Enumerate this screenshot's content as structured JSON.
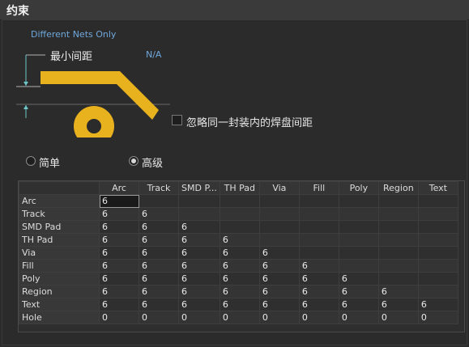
{
  "header": {
    "title": "约束"
  },
  "constraint": {
    "different_nets": "Different Nets Only",
    "min_clearance_label": "最小间距",
    "min_clearance_value": "N/A",
    "ignore_same_footprint_label": "忽略同一封装内的焊盘间距",
    "ignore_same_footprint_checked": false
  },
  "mode": {
    "simple_label": "简单",
    "advanced_label": "高级",
    "selected": "advanced"
  },
  "colors": {
    "accent_blue": "#6fa8dc",
    "pad_yellow": "#e8b21f",
    "guide_teal": "#6ec6c6"
  },
  "matrix": {
    "columns": [
      "Arc",
      "Track",
      "SMD P...",
      "TH Pad",
      "Via",
      "Fill",
      "Poly",
      "Region",
      "Text"
    ],
    "rows": [
      {
        "label": "Arc",
        "values": [
          "6",
          "",
          "",
          "",
          "",
          "",
          "",
          "",
          ""
        ]
      },
      {
        "label": "Track",
        "values": [
          "6",
          "6",
          "",
          "",
          "",
          "",
          "",
          "",
          ""
        ]
      },
      {
        "label": "SMD Pad",
        "values": [
          "6",
          "6",
          "6",
          "",
          "",
          "",
          "",
          "",
          ""
        ]
      },
      {
        "label": "TH Pad",
        "values": [
          "6",
          "6",
          "6",
          "6",
          "",
          "",
          "",
          "",
          ""
        ]
      },
      {
        "label": "Via",
        "values": [
          "6",
          "6",
          "6",
          "6",
          "6",
          "",
          "",
          "",
          ""
        ]
      },
      {
        "label": "Fill",
        "values": [
          "6",
          "6",
          "6",
          "6",
          "6",
          "6",
          "",
          "",
          ""
        ]
      },
      {
        "label": "Poly",
        "values": [
          "6",
          "6",
          "6",
          "6",
          "6",
          "6",
          "6",
          "",
          ""
        ]
      },
      {
        "label": "Region",
        "values": [
          "6",
          "6",
          "6",
          "6",
          "6",
          "6",
          "6",
          "6",
          ""
        ]
      },
      {
        "label": "Text",
        "values": [
          "6",
          "6",
          "6",
          "6",
          "6",
          "6",
          "6",
          "6",
          "6"
        ]
      },
      {
        "label": "Hole",
        "values": [
          "0",
          "0",
          "0",
          "0",
          "0",
          "0",
          "0",
          "0",
          "0"
        ]
      }
    ]
  }
}
